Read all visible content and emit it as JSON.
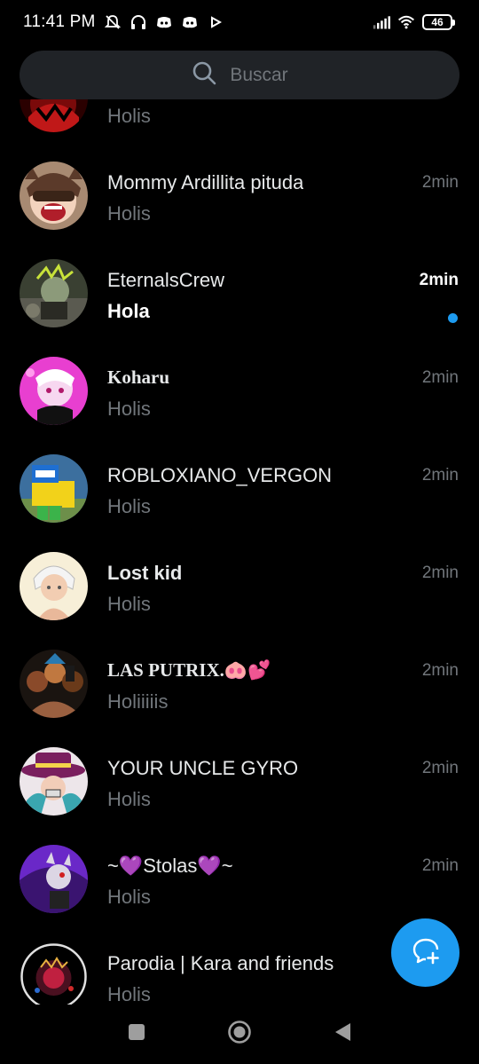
{
  "status_bar": {
    "time": "11:41 PM",
    "battery": "46",
    "icons": [
      "do-not-disturb-icon",
      "headphones-icon",
      "discord-icon",
      "discord-icon",
      "play-icon",
      "signal-icon",
      "wifi-icon",
      "battery-icon"
    ]
  },
  "search": {
    "placeholder": "Buscar"
  },
  "conversations": [
    {
      "name": "",
      "preview": "Holis",
      "time": "",
      "unread": false
    },
    {
      "name": "Mommy Ardillita pituda",
      "preview": "Holis",
      "time": "2min",
      "unread": false
    },
    {
      "name": "EternalsCrew",
      "preview": "Hola",
      "time": "2min",
      "unread": true
    },
    {
      "name": "Koharu",
      "preview": "Holis",
      "time": "2min",
      "unread": false
    },
    {
      "name": "ROBLOXIANO_VERGON",
      "preview": "Holis",
      "time": "2min",
      "unread": false
    },
    {
      "name": "Lost kid",
      "preview": "Holis",
      "time": "2min",
      "unread": false
    },
    {
      "name": "LAS PUTRIX.🐽💕",
      "preview": "Holiiiiis",
      "time": "2min",
      "unread": false
    },
    {
      "name": "YOUR UNCLE GYRO",
      "preview": "Holis",
      "time": "2min",
      "unread": false
    },
    {
      "name": "~💜Stolas💜~",
      "preview": "Holis",
      "time": "2min",
      "unread": false
    },
    {
      "name": "Parodia | Kara and friends",
      "preview": "Holis",
      "time": "",
      "unread": false
    }
  ],
  "colors": {
    "accent": "#1d9bf0",
    "background": "#000000",
    "search_bg": "#202327",
    "secondary_text": "#71767b"
  },
  "fab": {
    "icon": "new-message-icon"
  },
  "nav": {
    "icons": [
      "recents-square-icon",
      "home-circle-icon",
      "back-triangle-icon"
    ]
  }
}
